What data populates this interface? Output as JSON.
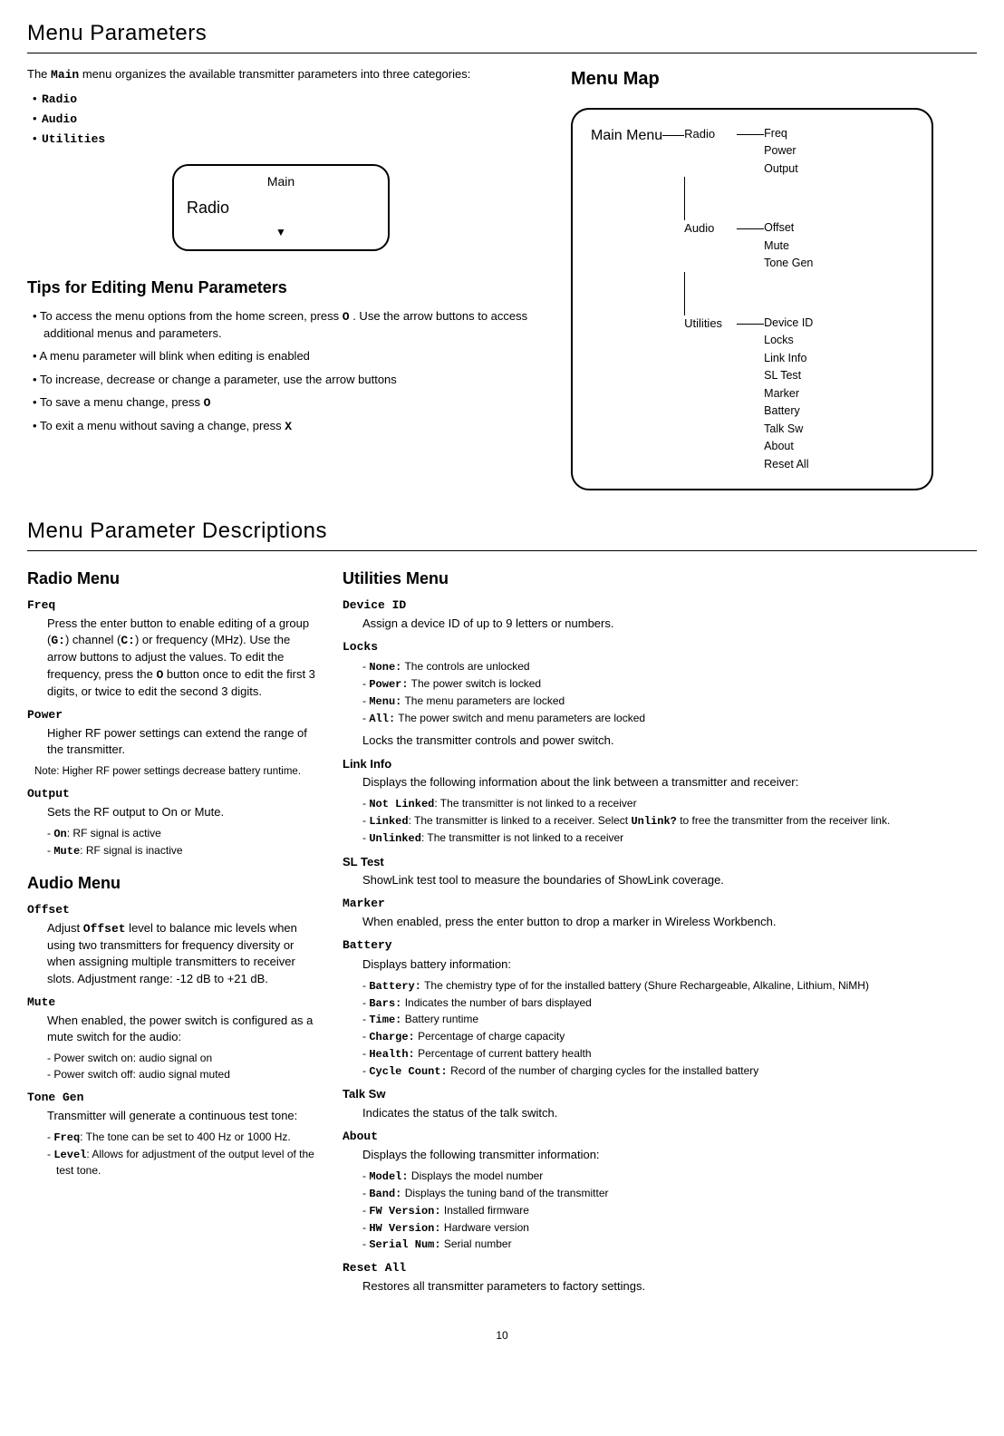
{
  "page_number": "10",
  "section1": {
    "title": "Menu Parameters",
    "intro_a": "The ",
    "intro_b": "Main",
    "intro_c": " menu organizes the available transmitter parameters into three categories:",
    "cats": [
      "Radio",
      "Audio",
      "Utilities"
    ],
    "lcd": {
      "top": "Main",
      "body": "Radio",
      "arrow": "▼"
    },
    "tips_heading": "Tips for Editing Menu Parameters",
    "tips": [
      {
        "a": "To access the menu options from the home screen, press ",
        "m": "O",
        "b": " . Use the arrow buttons to access additional menus and parameters."
      },
      {
        "a": "A menu parameter will blink when editing is enabled",
        "m": "",
        "b": ""
      },
      {
        "a": "To increase, decrease or change a parameter, use the arrow buttons",
        "m": "",
        "b": ""
      },
      {
        "a": "To save a menu change, press ",
        "m": "O",
        "b": ""
      },
      {
        "a": "To exit a menu without saving a change, press ",
        "m": "X",
        "b": ""
      }
    ],
    "menu_map_heading": "Menu Map",
    "map": {
      "main": "Main Menu",
      "radio": {
        "label": "Radio",
        "items": [
          "Freq",
          "Power",
          "Output"
        ]
      },
      "audio": {
        "label": "Audio",
        "items": [
          "Offset",
          "Mute",
          "Tone Gen"
        ]
      },
      "utilities": {
        "label": "Utilities",
        "items": [
          "Device ID",
          "Locks",
          "Link Info",
          "SL Test",
          "Marker",
          "Battery",
          "Talk Sw",
          "About",
          "Reset All"
        ]
      }
    }
  },
  "section2": {
    "title": "Menu Parameter Descriptions",
    "radio_h": "Radio Menu",
    "freq_name": "Freq",
    "freq_a": "Press the enter button to enable editing of a group (",
    "freq_g": "G:",
    "freq_b": ") channel (",
    "freq_c": "C:",
    "freq_d": ") or frequency (MHz). Use the arrow buttons to adjust the values. To edit the frequency, press the ",
    "freq_o": "O",
    "freq_e": " button once to edit the first 3 digits, or twice to edit the second 3 digits.",
    "power_name": "Power",
    "power_body": "Higher RF power settings can extend the range of the transmitter.",
    "power_note": "Note: Higher RF power settings decrease battery runtime.",
    "output_name": "Output",
    "output_body": "Sets the RF output to On or Mute.",
    "output_sub": [
      {
        "m": "On",
        "t": ": RF signal is active"
      },
      {
        "m": "Mute",
        "t": ": RF signal is inactive"
      }
    ],
    "audio_h": "Audio Menu",
    "offset_name": "Offset",
    "offset_a": "Adjust ",
    "offset_m": "Offset",
    "offset_b": " level to balance mic levels when using two transmitters for frequency diversity or when assigning multiple transmitters to receiver slots. Adjustment range: -12 dB to +21 dB.",
    "mute_name": "Mute",
    "mute_body": "When enabled, the power switch is configured as a mute switch for the audio:",
    "mute_sub": [
      {
        "t": "Power switch on: audio signal on"
      },
      {
        "t": "Power switch off: audio signal muted"
      }
    ],
    "tonegen_name": "Tone Gen",
    "tonegen_body": "Transmitter will generate a continuous test tone:",
    "tonegen_sub": [
      {
        "m": "Freq",
        "t": ": The tone can be set to 400 Hz or 1000 Hz."
      },
      {
        "m": "Level",
        "t": ": Allows for adjustment of the output level of the test tone."
      }
    ],
    "util_h": "Utilities Menu",
    "deviceid_name": "Device ID",
    "deviceid_body": "Assign a device ID of up to 9 letters or numbers.",
    "locks_name": "Locks",
    "locks_sub": [
      {
        "m": "None:",
        "t": " The controls are unlocked"
      },
      {
        "m": "Power:",
        "t": " The power switch is locked"
      },
      {
        "m": "Menu:",
        "t": " The menu parameters are locked"
      },
      {
        "m": "All:",
        "t": " The power switch and menu parameters are locked"
      }
    ],
    "locks_body": "Locks the transmitter controls and power switch.",
    "linkinfo_name": "Link Info",
    "linkinfo_body": "Displays the following information about the link between a transmitter and receiver:",
    "linkinfo_sub": [
      {
        "m": "Not Linked",
        "t": ": The transmitter is not linked to a receiver"
      },
      {
        "m": "Linked",
        "t1": ": The transmitter is linked to a receiver. Select ",
        "m2": "Unlink?",
        "t2": " to free the transmitter from the receiver link."
      },
      {
        "m": "Unlinked",
        "t": ": The transmitter is not linked to a receiver"
      }
    ],
    "sltest_name": "SL Test",
    "sltest_body": "ShowLink test tool to measure the boundaries of ShowLink coverage.",
    "marker_name": "Marker",
    "marker_body": "When enabled, press the enter button to drop a marker in Wireless Workbench.",
    "battery_name": "Battery",
    "battery_body": "Displays battery information:",
    "battery_sub": [
      {
        "m": "Battery:",
        "t": " The chemistry type of for the installed battery (Shure Rechargeable, Alkaline, Lithium, NiMH)"
      },
      {
        "m": "Bars:",
        "t": " Indicates the number of bars displayed"
      },
      {
        "m": "Time:",
        "t": " Battery runtime"
      },
      {
        "m": "Charge:",
        "t": " Percentage of charge capacity"
      },
      {
        "m": "Health:",
        "t": " Percentage of current battery health"
      },
      {
        "m": "Cycle Count:",
        "t": " Record of the number of charging cycles for the installed battery"
      }
    ],
    "talksw_name": "Talk Sw",
    "talksw_body": "Indicates the status of the talk switch.",
    "about_name": "About",
    "about_body": "Displays the following transmitter information:",
    "about_sub": [
      {
        "m": "Model:",
        "t": " Displays the model number"
      },
      {
        "m": "Band:",
        "t": " Displays the tuning band of the transmitter"
      },
      {
        "m": "FW Version:",
        "t": " Installed firmware"
      },
      {
        "m": "HW Version:",
        "t": " Hardware version"
      },
      {
        "m": "Serial Num:",
        "t": " Serial number"
      }
    ],
    "resetall_name": "Reset All",
    "resetall_body": "Restores all transmitter parameters to factory settings."
  }
}
